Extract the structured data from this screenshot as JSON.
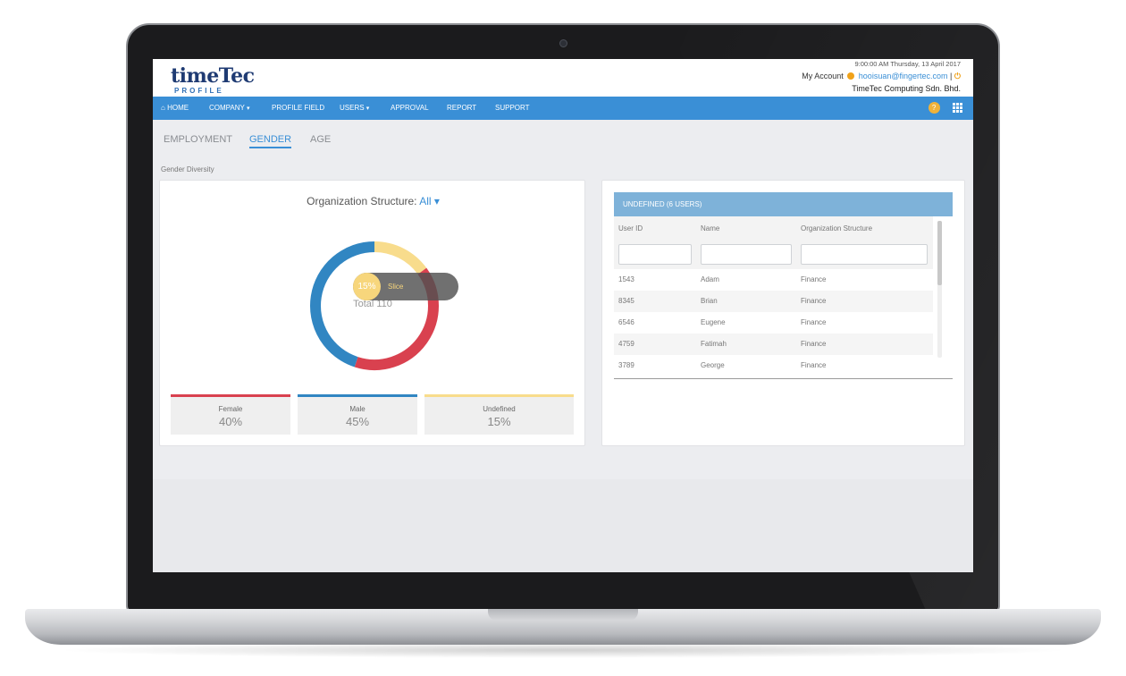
{
  "header": {
    "logo_main": "timeTec",
    "logo_sub": "PROFILE",
    "datetime": "9:00:00 AM Thursday, 13 April 2017",
    "my_account_label": "My Account",
    "email": "hooisuan@fingertec.com",
    "separator": "|",
    "company": "TimeTec Computing Sdn. Bhd."
  },
  "nav": {
    "items": [
      {
        "label": "HOME",
        "icon": "home-icon"
      },
      {
        "label": "COMPANY",
        "caret": "▾"
      },
      {
        "label": "PROFILE FIELD"
      },
      {
        "label": "USERS",
        "caret": "▾"
      },
      {
        "label": "APPROVAL"
      },
      {
        "label": "REPORT"
      },
      {
        "label": "SUPPORT"
      }
    ],
    "right_icons": [
      "help-icon",
      "apps-grid-icon"
    ]
  },
  "tabs": [
    {
      "label": "EMPLOYMENT",
      "active": false
    },
    {
      "label": "GENDER",
      "active": true
    },
    {
      "label": "AGE",
      "active": false
    }
  ],
  "section_label": "Gender Diversity",
  "chart_panel": {
    "org_label": "Organization Structure:",
    "org_value": "All",
    "tooltip_value": "15%",
    "tooltip_label": "Slice",
    "total_label": "Total 110",
    "legend": [
      {
        "name": "Female",
        "value": "40%",
        "color": "#d9414f"
      },
      {
        "name": "Male",
        "value": "45%",
        "color": "#3186c2"
      },
      {
        "name": "Undefined",
        "value": "15%",
        "color": "#f8dc8c"
      }
    ]
  },
  "chart_data": {
    "type": "pie",
    "categories": [
      "Female",
      "Male",
      "Undefined"
    ],
    "values": [
      40,
      45,
      15
    ],
    "colors": [
      "#d9414f",
      "#3186c2",
      "#f8dc8c"
    ],
    "title": "",
    "donut": true
  },
  "table": {
    "title": "UNDEFINED (6 USERS)",
    "columns": [
      "User ID",
      "Name",
      "Organization Structure"
    ],
    "rows": [
      [
        "1543",
        "Adam",
        "Finance"
      ],
      [
        "8345",
        "Brian",
        "Finance"
      ],
      [
        "6546",
        "Eugene",
        "Finance"
      ],
      [
        "4759",
        "Fatimah",
        "Finance"
      ],
      [
        "3789",
        "George",
        "Finance"
      ]
    ]
  },
  "colors": {
    "brand_blue": "#3a8fd6",
    "table_header": "#7eb2d9",
    "accent_orange": "#f0a21a"
  }
}
